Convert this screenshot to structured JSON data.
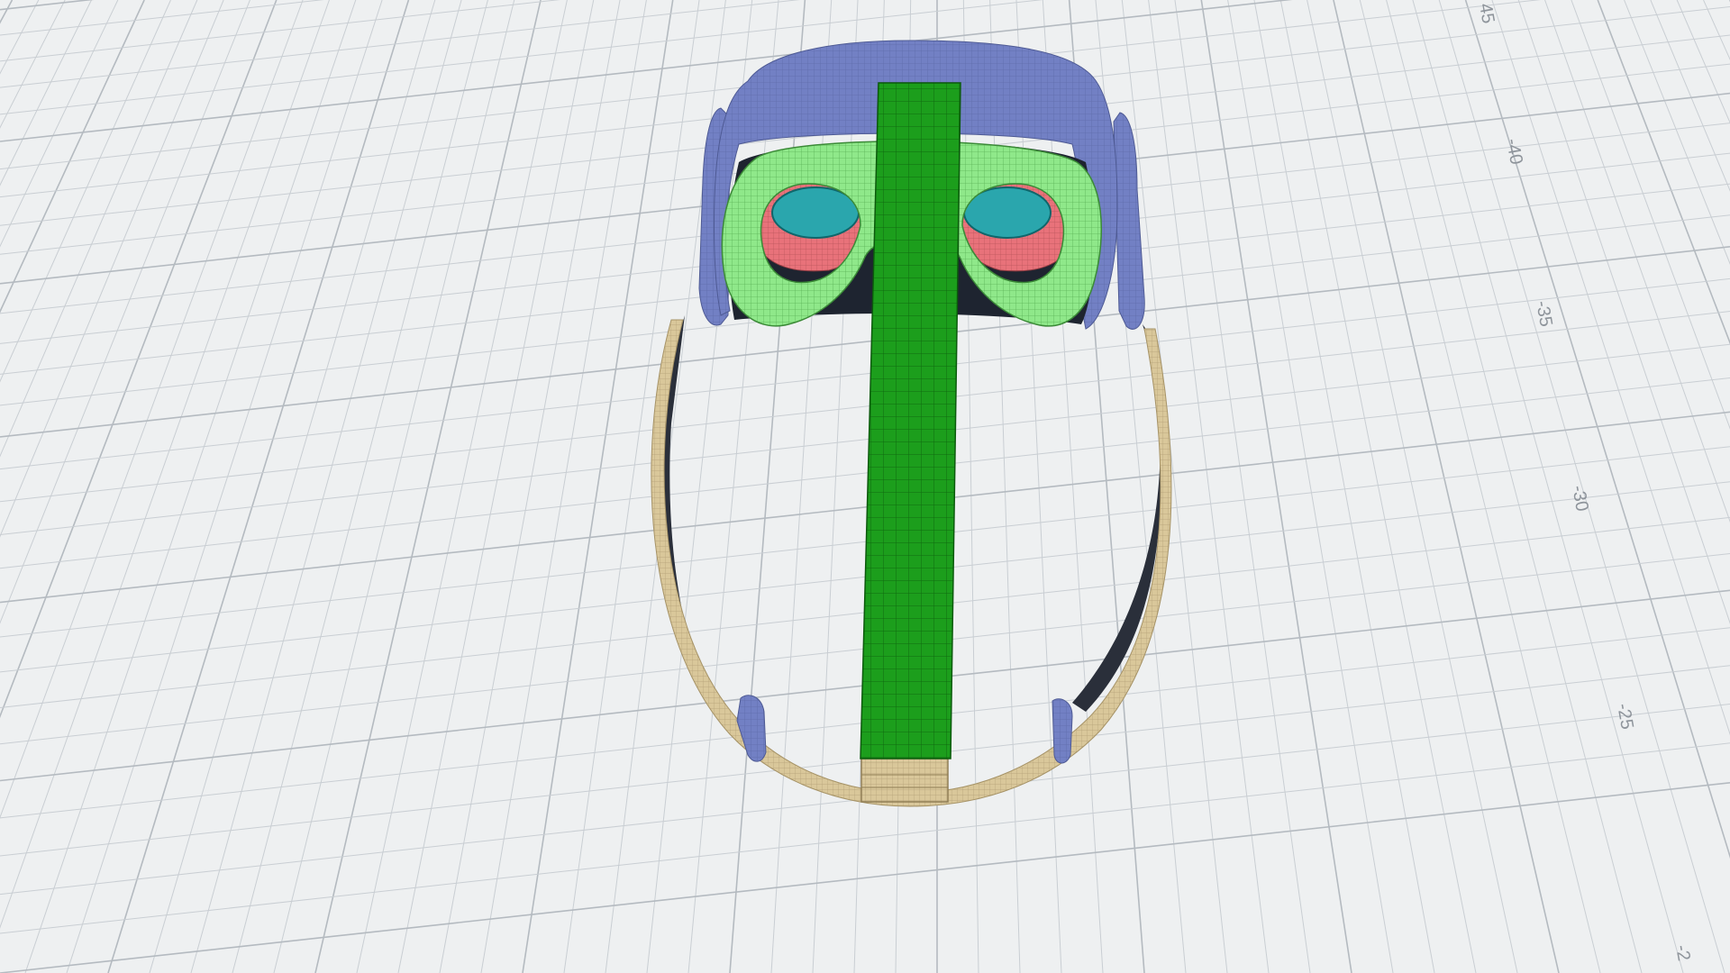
{
  "scene": {
    "view": "3D perspective viewport",
    "background_color": "#eef0f1",
    "grid_minor_color": "#c9ced3",
    "grid_major_color": "#b4bac0",
    "model_colors": {
      "shell": "#7280c4",
      "face_cushion": "#8fe88a",
      "lens_rim": "#e8727a",
      "lens": "#2aa6ad",
      "top_strap": "#1c9e1c",
      "side_strap": "#d9c79a",
      "strap_clip": "#6e7cc0"
    }
  },
  "ruler": {
    "labels": [
      "45",
      "-40",
      "-35",
      "-30",
      "-25",
      "-2"
    ]
  }
}
